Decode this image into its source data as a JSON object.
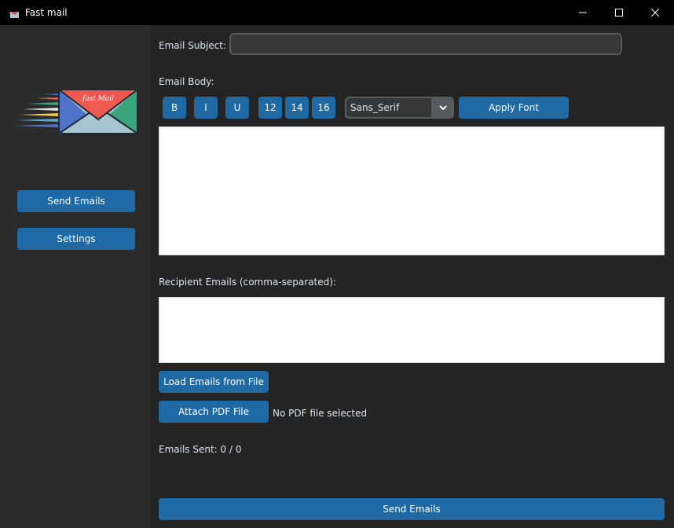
{
  "window": {
    "title": "Fast mail"
  },
  "sidebar": {
    "logo_text": "fast Mail",
    "buttons": [
      {
        "label": "Send Emails"
      },
      {
        "label": "Settings"
      }
    ]
  },
  "main": {
    "subject_label": "Email Subject:",
    "subject_value": "",
    "body_label": "Email Body:",
    "format_buttons": [
      {
        "label": "B"
      },
      {
        "label": "I"
      },
      {
        "label": "U"
      },
      {
        "label": "12"
      },
      {
        "label": "14"
      },
      {
        "label": "16"
      }
    ],
    "font_select": {
      "value": "Sans_Serif"
    },
    "apply_font_label": "Apply Font",
    "body_value": "",
    "recipients_label": "Recipient Emails (comma-separated):",
    "recipients_value": "",
    "load_emails_label": "Load Emails from File",
    "attach_pdf_label": "Attach PDF File",
    "pdf_status": "No PDF file selected",
    "emails_sent": "Emails Sent: 0 / 0",
    "send_button_label": "Send Emails"
  },
  "colors": {
    "accent": "#1f6aa5",
    "background": "#242424",
    "sidebar": "#2b2b2b",
    "titlebar": "#000000",
    "text": "#dce4ee"
  }
}
